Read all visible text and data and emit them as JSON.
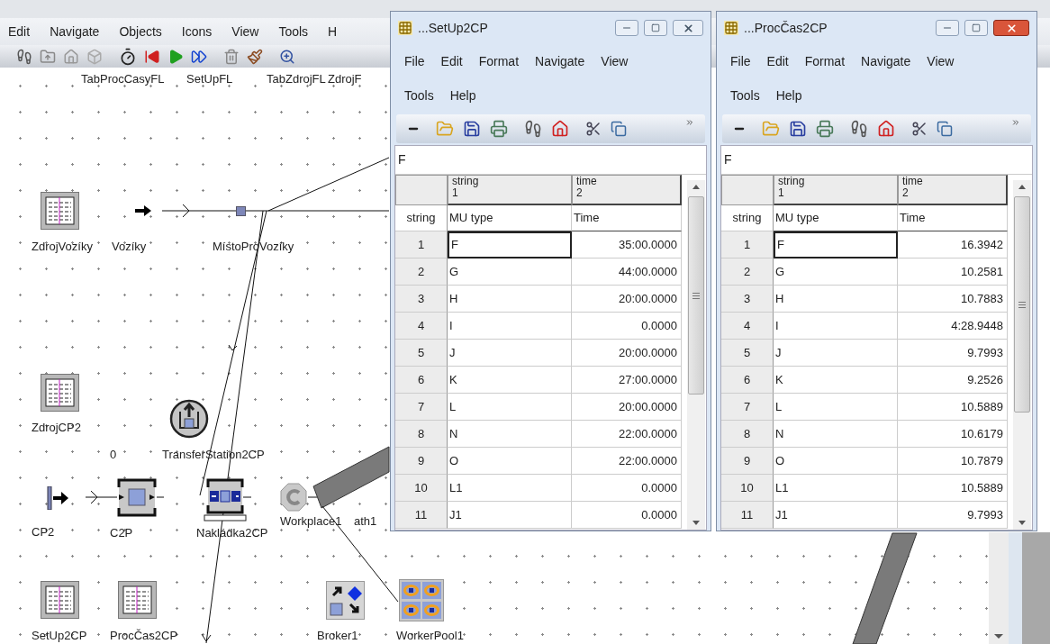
{
  "main_menu": [
    "Edit",
    "Navigate",
    "Objects",
    "Icons",
    "View",
    "Tools",
    "H"
  ],
  "canvas": {
    "top_labels": [
      "TabProcCasyFL",
      "SetUpFL",
      "TabZdrojFL",
      "ZdrojF"
    ],
    "objects": [
      {
        "kind": "table",
        "label": "ZdrojVozíky"
      },
      {
        "kind": "arrow",
        "label": "Vozíky"
      },
      {
        "kind": "place",
        "label": "MístoProVozíky"
      },
      {
        "kind": "table",
        "label": "ZdrojCP2"
      },
      {
        "kind": "text",
        "label": "0"
      },
      {
        "kind": "transfer",
        "label": "TransferStation2CP"
      },
      {
        "kind": "source",
        "label": "CP2"
      },
      {
        "kind": "station",
        "label": "C2P"
      },
      {
        "kind": "assembly",
        "label": "Nakládka2CP"
      },
      {
        "kind": "workplace",
        "label": "Workplace1"
      },
      {
        "kind": "text",
        "label": "ath1"
      },
      {
        "kind": "table",
        "label": "SetUp2CP"
      },
      {
        "kind": "table",
        "label": "ProcČas2CP"
      },
      {
        "kind": "broker",
        "label": "Broker1"
      },
      {
        "kind": "workerpool",
        "label": "WorkerPool1"
      }
    ]
  },
  "windows": [
    {
      "title": "...SetUp2CP",
      "active": false,
      "menu": [
        "File",
        "Edit",
        "Format",
        "Navigate",
        "View",
        "Tools",
        "Help"
      ],
      "formula": "F",
      "columns": [
        {
          "type": "string",
          "index": "1"
        },
        {
          "type": "time",
          "index": "2"
        }
      ],
      "row_header": "string",
      "column_titles": [
        "MU type",
        "Time"
      ],
      "rows": [
        {
          "index": "1",
          "mu_type": "F",
          "time": "35:00.0000",
          "selected": true
        },
        {
          "index": "2",
          "mu_type": "G",
          "time": "44:00.0000",
          "selected": false
        },
        {
          "index": "3",
          "mu_type": "H",
          "time": "20:00.0000",
          "selected": false
        },
        {
          "index": "4",
          "mu_type": "I",
          "time": "0.0000",
          "selected": false
        },
        {
          "index": "5",
          "mu_type": "J",
          "time": "20:00.0000",
          "selected": false
        },
        {
          "index": "6",
          "mu_type": "K",
          "time": "27:00.0000",
          "selected": false
        },
        {
          "index": "7",
          "mu_type": "L",
          "time": "20:00.0000",
          "selected": false
        },
        {
          "index": "8",
          "mu_type": "N",
          "time": "22:00.0000",
          "selected": false
        },
        {
          "index": "9",
          "mu_type": "O",
          "time": "22:00.0000",
          "selected": false
        },
        {
          "index": "10",
          "mu_type": "L1",
          "time": "0.0000",
          "selected": false
        },
        {
          "index": "11",
          "mu_type": "J1",
          "time": "0.0000",
          "selected": false
        }
      ]
    },
    {
      "title": "...ProcČas2CP",
      "active": true,
      "menu": [
        "File",
        "Edit",
        "Format",
        "Navigate",
        "View",
        "Tools",
        "Help"
      ],
      "formula": "F",
      "columns": [
        {
          "type": "string",
          "index": "1"
        },
        {
          "type": "time",
          "index": "2"
        }
      ],
      "row_header": "string",
      "column_titles": [
        "MU type",
        "Time"
      ],
      "rows": [
        {
          "index": "1",
          "mu_type": "F",
          "time": "16.3942",
          "selected": true
        },
        {
          "index": "2",
          "mu_type": "G",
          "time": "10.2581",
          "selected": false
        },
        {
          "index": "3",
          "mu_type": "H",
          "time": "10.7883",
          "selected": false
        },
        {
          "index": "4",
          "mu_type": "I",
          "time": "4:28.9448",
          "selected": false
        },
        {
          "index": "5",
          "mu_type": "J",
          "time": "9.7993",
          "selected": false
        },
        {
          "index": "6",
          "mu_type": "K",
          "time": "9.2526",
          "selected": false
        },
        {
          "index": "7",
          "mu_type": "L",
          "time": "10.5889",
          "selected": false
        },
        {
          "index": "8",
          "mu_type": "N",
          "time": "10.6179",
          "selected": false
        },
        {
          "index": "9",
          "mu_type": "O",
          "time": "10.7879",
          "selected": false
        },
        {
          "index": "10",
          "mu_type": "L1",
          "time": "10.5889",
          "selected": false
        },
        {
          "index": "11",
          "mu_type": "J1",
          "time": "9.7993",
          "selected": false
        }
      ]
    }
  ]
}
